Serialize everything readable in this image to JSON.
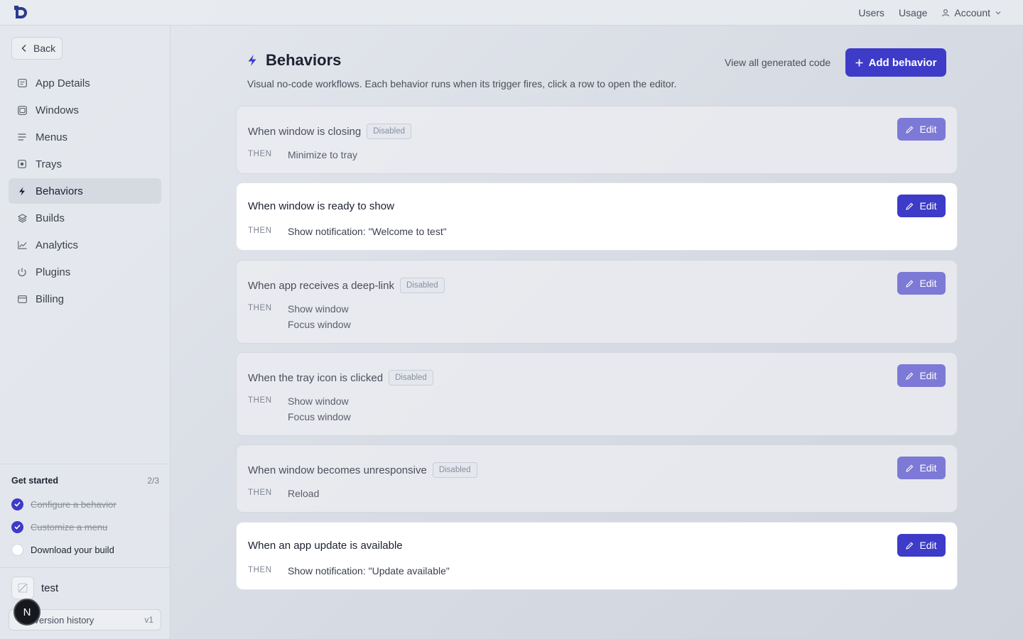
{
  "topbar": {
    "nav": [
      "Users",
      "Usage"
    ],
    "account_label": "Account"
  },
  "sidebar": {
    "back_label": "Back",
    "items": [
      {
        "label": "App Details",
        "icon": "card-icon"
      },
      {
        "label": "Windows",
        "icon": "window-icon"
      },
      {
        "label": "Menus",
        "icon": "lines-icon"
      },
      {
        "label": "Trays",
        "icon": "tray-icon"
      },
      {
        "label": "Behaviors",
        "icon": "bolt-icon",
        "active": true
      },
      {
        "label": "Builds",
        "icon": "layers-icon"
      },
      {
        "label": "Analytics",
        "icon": "chart-icon"
      },
      {
        "label": "Plugins",
        "icon": "plug-icon"
      },
      {
        "label": "Billing",
        "icon": "billing-icon"
      }
    ],
    "get_started": {
      "title": "Get started",
      "count": "2/3",
      "items": [
        {
          "label": "Configure a behavior",
          "done": true
        },
        {
          "label": "Customize a menu",
          "done": true
        },
        {
          "label": "Download your build",
          "done": false
        }
      ]
    },
    "app_name": "test",
    "version_label": "Version history",
    "version": "v1",
    "avatar_letter": "N"
  },
  "main": {
    "title": "Behaviors",
    "subtitle": "Visual no-code workflows. Each behavior runs when its trigger fires, click a row to open the editor.",
    "view_code_label": "View all generated code",
    "add_label": "Add behavior",
    "then_label": "THEN",
    "edit_label": "Edit",
    "disabled_label": "Disabled",
    "behaviors": [
      {
        "trigger": "When window is closing",
        "enabled": false,
        "actions": [
          "Minimize to tray"
        ]
      },
      {
        "trigger": "When window is ready to show",
        "enabled": true,
        "actions": [
          "Show notification: \"Welcome to test\""
        ]
      },
      {
        "trigger": "When app receives a deep-link",
        "enabled": false,
        "actions": [
          "Show window",
          "Focus window"
        ]
      },
      {
        "trigger": "When the tray icon is clicked",
        "enabled": false,
        "actions": [
          "Show window",
          "Focus window"
        ]
      },
      {
        "trigger": "When window becomes unresponsive",
        "enabled": false,
        "actions": [
          "Reload"
        ]
      },
      {
        "trigger": "When an app update is available",
        "enabled": true,
        "actions": [
          "Show notification: \"Update available\""
        ]
      }
    ]
  },
  "colors": {
    "accent": "#3d3bc8",
    "accent_muted": "#7d79d6"
  }
}
